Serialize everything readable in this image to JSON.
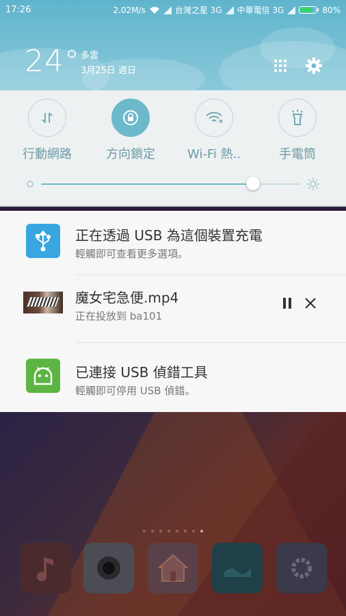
{
  "status_bar": {
    "time": "17:26",
    "speed": "2.02M/s",
    "carrier1": "台灣之星 3G",
    "carrier2": "中華電信 3G",
    "battery": "80%",
    "battery_level": 0.8,
    "battery_color": "#35d46a"
  },
  "weather": {
    "temperature": "24°",
    "condition": "多雲",
    "date": "3月25日 週日",
    "apps_icon": "grid-icon",
    "settings_icon": "gear-icon"
  },
  "quick_toggles": [
    {
      "label": "行動網路",
      "icon": "mobile-data-icon",
      "active": false
    },
    {
      "label": "方向鎖定",
      "icon": "rotation-lock-icon",
      "active": true
    },
    {
      "label": "Wi-Fi 熱..",
      "icon": "wifi-hotspot-icon",
      "active": false
    },
    {
      "label": "手電筒",
      "icon": "flashlight-icon",
      "active": false
    }
  ],
  "brightness": {
    "level": 0.82,
    "accent": "#6db9cc"
  },
  "notifications": [
    {
      "title": "正在透過 USB 為這個裝置充電",
      "subtitle": "輕觸即可查看更多選項。",
      "icon": "usb-icon",
      "color": "#39a6e0"
    },
    {
      "title": "魔女宅急便.mp4",
      "subtitle": "正在投放到 ba101",
      "icon": "video-thumbnail",
      "pause_icon": "pause-icon",
      "close_icon": "close-icon"
    },
    {
      "title": "已連接 USB 偵錯工具",
      "subtitle": "輕觸即可停用 USB 偵錯。",
      "icon": "android-debug-icon",
      "color": "#5cb543"
    }
  ],
  "dock": [
    {
      "icon": "music-icon"
    },
    {
      "icon": "camera-icon"
    },
    {
      "icon": "home-app-icon"
    },
    {
      "icon": "gallery-icon"
    },
    {
      "icon": "settings-icon"
    }
  ]
}
